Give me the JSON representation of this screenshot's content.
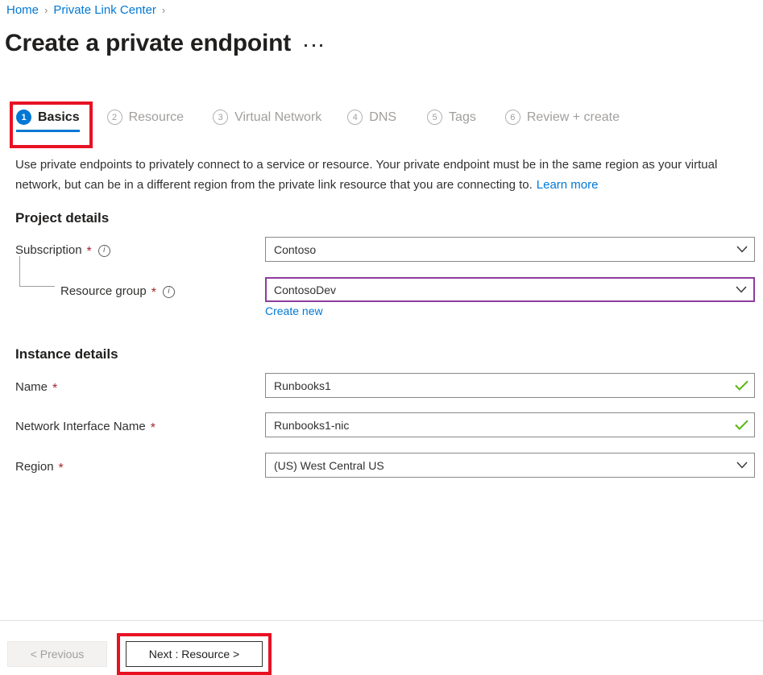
{
  "breadcrumb": {
    "items": [
      {
        "label": "Home"
      },
      {
        "label": "Private Link Center"
      }
    ],
    "separator": "›"
  },
  "header": {
    "title": "Create a private endpoint",
    "more_menu": "⋯"
  },
  "tabs": [
    {
      "number": "1",
      "label": "Basics",
      "state": "active"
    },
    {
      "number": "2",
      "label": "Resource",
      "state": "inactive"
    },
    {
      "number": "3",
      "label": "Virtual Network",
      "state": "inactive"
    },
    {
      "number": "4",
      "label": "DNS",
      "state": "inactive"
    },
    {
      "number": "5",
      "label": "Tags",
      "state": "inactive"
    },
    {
      "number": "6",
      "label": "Review + create",
      "state": "inactive"
    }
  ],
  "description": {
    "text": "Use private endpoints to privately connect to a service or resource. Your private endpoint must be in the same region as your virtual network, but can be in a different region from the private link resource that you are connecting to.",
    "link_label": "Learn more"
  },
  "project_details": {
    "heading": "Project details",
    "subscription": {
      "label": "Subscription",
      "required": "*",
      "info": "i",
      "value": "Contoso"
    },
    "resource_group": {
      "label": "Resource group",
      "required": "*",
      "info": "i",
      "value": "ContosoDev",
      "create_new_label": "Create new"
    }
  },
  "instance_details": {
    "heading": "Instance details",
    "name": {
      "label": "Name",
      "required": "*",
      "value": "Runbooks1"
    },
    "network_interface_name": {
      "label": "Network Interface Name",
      "required": "*",
      "value": "Runbooks1-nic"
    },
    "region": {
      "label": "Region",
      "required": "*",
      "value": "(US) West Central US"
    }
  },
  "footer": {
    "previous_label": "< Previous",
    "next_label": "Next : Resource >"
  },
  "colors": {
    "accent_blue": "#0078d4",
    "annotation_red": "#e81123",
    "focus_purple": "#8c3d9c",
    "required_red": "#a4262c",
    "validation_green": "#5ab510"
  }
}
